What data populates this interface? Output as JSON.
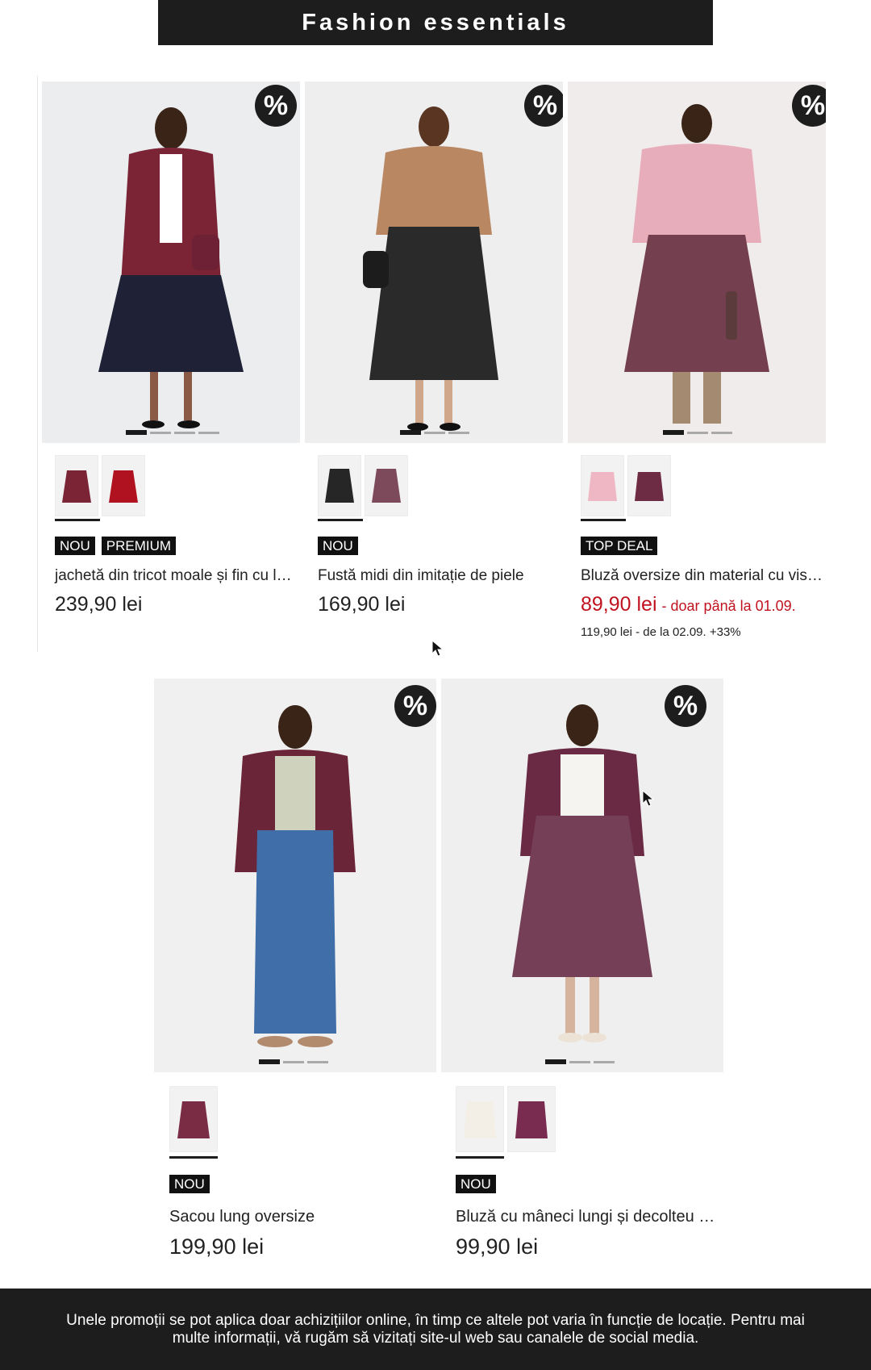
{
  "header": {
    "title": "Fashion essentials"
  },
  "colors": {
    "sale": "#c0131f",
    "dark": "#1d1d1d"
  },
  "products": [
    {
      "badge": "%",
      "tags": [
        "NOU",
        "PREMIUM"
      ],
      "name": "jachetă din tricot moale și fin cu l…",
      "price": "239,90 lei",
      "swatch_colors": [
        "#7a2436",
        "#b0121f"
      ],
      "carousel": {
        "count": 4,
        "active": 1
      }
    },
    {
      "badge": "%",
      "tags": [
        "NOU"
      ],
      "name": "Fustă midi din imitație de piele",
      "price": "169,90 lei",
      "swatch_colors": [
        "#262626",
        "#7c4a5a"
      ],
      "carousel": {
        "count": 4,
        "active": 1
      }
    },
    {
      "badge": "%",
      "tags": [
        "TOP DEAL"
      ],
      "name": "Bluză oversize din material cu vis…",
      "price": "89,90 lei",
      "price_note": "- doar până la 01.09.",
      "old_price": "119,90 lei - de la 02.09. +33%",
      "swatch_colors": [
        "#efb6c4",
        "#6e2c44"
      ],
      "carousel": {
        "count": 3,
        "active": 1
      }
    },
    {
      "badge": "%",
      "tags": [
        "NOU"
      ],
      "name": "Sacou lung oversize",
      "price": "199,90 lei",
      "swatch_colors": [
        "#7a2c44"
      ],
      "carousel": {
        "count": 3,
        "active": 1
      }
    },
    {
      "badge": "%",
      "tags": [
        "NOU"
      ],
      "name": "Bluză cu mâneci lungi și decolteu …",
      "price": "99,90 lei",
      "swatch_colors": [
        "#f3eee6",
        "#7a2c50"
      ],
      "carousel": {
        "count": 3,
        "active": 1
      }
    }
  ],
  "footer": {
    "text": "Unele promoții se pot aplica doar achizițiilor online, în timp ce altele pot varia în funcție de locație. Pentru mai multe informații, vă rugăm să vizitați site-ul web sau canalele de social media."
  }
}
